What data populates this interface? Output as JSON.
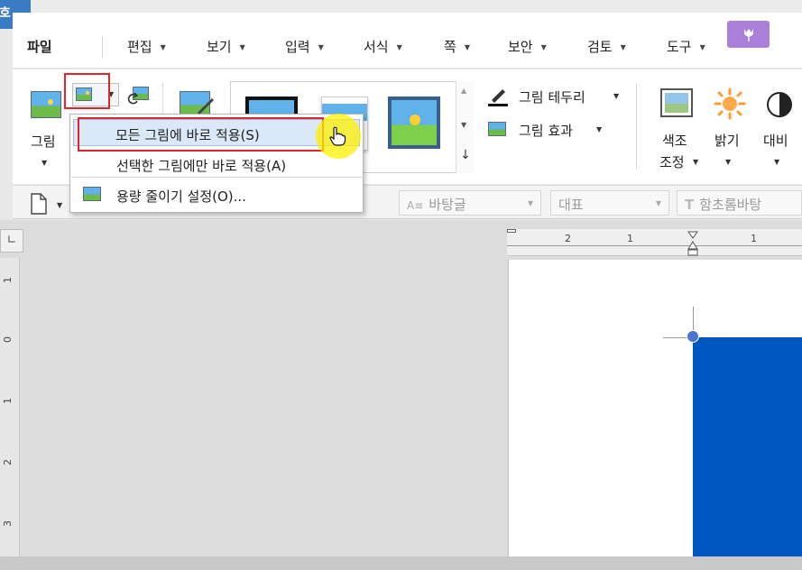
{
  "app": {
    "corner_label": "호"
  },
  "menu": {
    "items": [
      {
        "label": "파일"
      },
      {
        "label": "편집"
      },
      {
        "label": "보기"
      },
      {
        "label": "입력"
      },
      {
        "label": "서식"
      },
      {
        "label": "쪽"
      },
      {
        "label": "보안"
      },
      {
        "label": "검토"
      },
      {
        "label": "도구"
      }
    ]
  },
  "ribbon": {
    "picture_label": "그림",
    "border_label": "그림 테두리",
    "effect_label": "그림 효과",
    "color_label_1": "색조",
    "color_label_2": "조정",
    "brightness_label": "밝기",
    "contrast_label": "대비"
  },
  "dropdown": {
    "items": [
      {
        "label": "모든 그림에 바로 적용(S)"
      },
      {
        "label": "선택한 그림에만 바로 적용(A)"
      },
      {
        "label": "용량 줄이기 설정(O)..."
      }
    ]
  },
  "format_bar": {
    "style_placeholder": "바탕글",
    "para_placeholder": "대표",
    "font_placeholder": "함초롬바탕"
  },
  "ruler": {
    "h_labels": [
      "2",
      "1",
      "1"
    ],
    "v_labels": [
      "1",
      "0",
      "1",
      "2",
      "3"
    ]
  },
  "colors": {
    "accent": "#3a7cc3",
    "help_button": "#a97fd9",
    "highlight_red": "#e0262b",
    "selected_blue_shape": "#0057c2"
  }
}
